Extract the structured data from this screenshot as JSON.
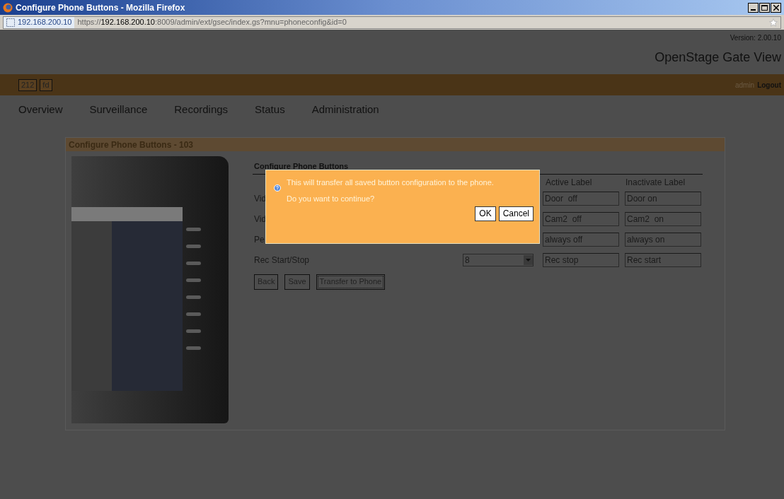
{
  "window": {
    "title": "Configure Phone Buttons - Mozilla Firefox"
  },
  "address_bar": {
    "site": "192.168.200.10",
    "url_scheme": "https://",
    "url_host": "192.168.200.10",
    "url_rest": ":8009/admin/ext/gsec/index.gs?mnu=phoneconfig&id=0"
  },
  "header": {
    "version": "Version: 2.00.10",
    "app_title": "OpenStage Gate View",
    "badges": [
      "212",
      "fd"
    ],
    "user": "admin",
    "logout": "Logout"
  },
  "nav": [
    {
      "label": "Overview"
    },
    {
      "label": "Surveillance"
    },
    {
      "label": "Recordings"
    },
    {
      "label": "Status"
    },
    {
      "label": "Administration"
    }
  ],
  "panel": {
    "title": "Configure Phone Buttons - 103",
    "form_title": "Configure Phone Buttons",
    "columns": [
      "Active Label",
      "Inactivate Label"
    ],
    "rows": [
      {
        "label": "Vid",
        "select": null,
        "active": "Door  off",
        "inactive": "Door on"
      },
      {
        "label": "Vid",
        "select": null,
        "active": "Cam2  off",
        "inactive": "Cam2  on"
      },
      {
        "label": "Pe",
        "select": null,
        "active": "always off",
        "inactive": "always on"
      },
      {
        "label": "Rec Start/Stop",
        "select": "8",
        "active": "Rec stop",
        "inactive": "Rec start"
      }
    ],
    "buttons": [
      "Back",
      "Save",
      "Transfer to Phone"
    ]
  },
  "dialog": {
    "message": "This will transfer all saved button configuration to the phone.",
    "question": "Do you want to continue?",
    "buttons": [
      "OK",
      "Cancel"
    ]
  }
}
